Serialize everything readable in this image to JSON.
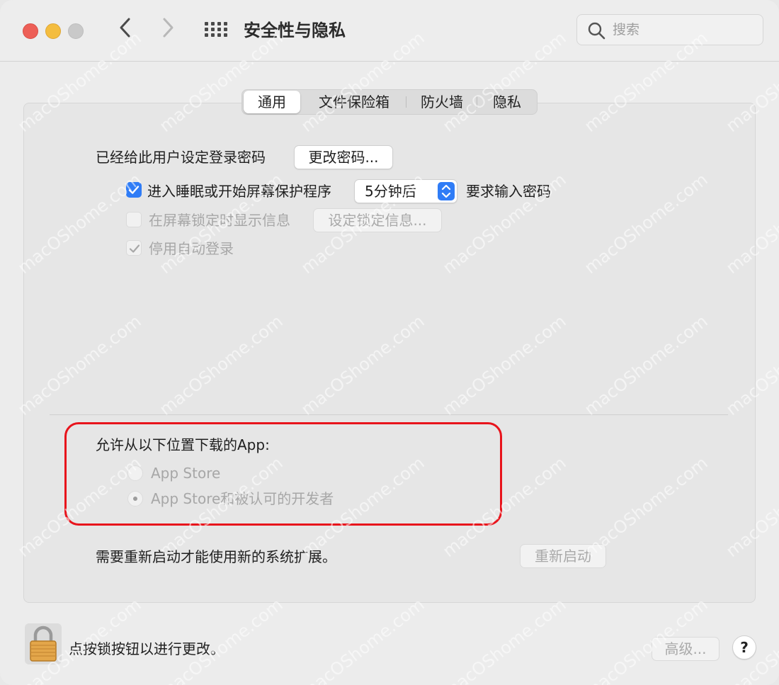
{
  "window": {
    "title": "安全性与隐私",
    "search_placeholder": "搜索"
  },
  "toolbar": {
    "back_glyph": "‹",
    "forward_glyph": "›"
  },
  "tabs": [
    {
      "label": "通用",
      "active": true
    },
    {
      "label": "文件保险箱",
      "active": false
    },
    {
      "label": "防火墙",
      "active": false
    },
    {
      "label": "隐私",
      "active": false
    }
  ],
  "general": {
    "password_set_text": "已经给此用户设定登录密码",
    "change_password_button": "更改密码...",
    "require_password": {
      "checked": true,
      "label_before": "进入睡眠或开始屏幕保护程序",
      "delay_value": "5分钟后",
      "label_after": "要求输入密码"
    },
    "show_message": {
      "checked": false,
      "enabled": false,
      "label": "在屏幕锁定时显示信息",
      "button": "设定锁定信息..."
    },
    "disable_auto_login": {
      "checked": true,
      "enabled": false,
      "label": "停用自动登录"
    }
  },
  "downloads": {
    "heading": "允许从以下位置下载的App:",
    "options": [
      {
        "label": "App Store",
        "selected": false
      },
      {
        "label": "App Store和被认可的开发者",
        "selected": true
      }
    ]
  },
  "restart": {
    "text": "需要重新启动才能使用新的系统扩展。",
    "button": "重新启动"
  },
  "footer": {
    "lock_text": "点按锁按钮以进行更改。",
    "advanced_button": "高级...",
    "help_label": "?"
  },
  "colors": {
    "accent": "#2f7cf6",
    "highlight_border": "#e8141c",
    "traffic_close": "#ed5f57",
    "traffic_minimize": "#f4bd3f"
  },
  "icons": {
    "lock": "lock-icon",
    "search": "search-icon",
    "grid": "grid-icon"
  },
  "watermark": "macOShome.com"
}
